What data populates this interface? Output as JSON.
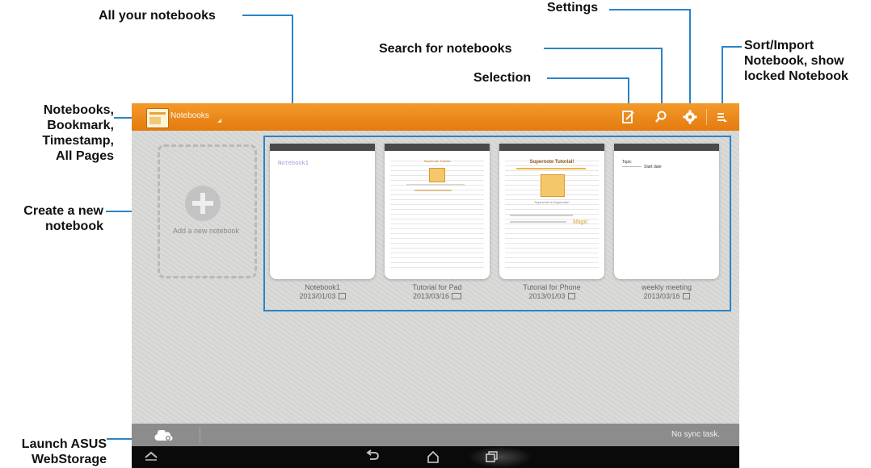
{
  "annotations": {
    "all_notebooks": "All your notebooks",
    "settings": "Settings",
    "search": "Search for notebooks",
    "selection": "Selection",
    "sort_import": [
      "Sort/Import",
      "Notebook, show",
      "locked Notebook"
    ],
    "notebooks_menu": [
      "Notebooks,",
      "Bookmark,",
      "Timestamp,",
      "All Pages"
    ],
    "create_new": [
      "Create a new",
      "notebook"
    ],
    "launch_storage": [
      "Launch ASUS",
      "WebStorage"
    ]
  },
  "app": {
    "title": "Notebooks",
    "icons": [
      "selection-icon",
      "search-icon",
      "settings-icon",
      "sort-menu-icon"
    ],
    "accent_color": "#e8820f"
  },
  "add_notebook": {
    "label": "Add a new notebook"
  },
  "notebooks": [
    {
      "name": "Notebook1",
      "date": "2013/01/03"
    },
    {
      "name": "Tutorial for Pad",
      "date": "2013/03/16"
    },
    {
      "name": "Tutorial for Phone",
      "date": "2013/01/03"
    },
    {
      "name": "weekly meeting",
      "date": "2013/03/16"
    }
  ],
  "thumbs": {
    "nb1": "Notebook1",
    "pad_title": "Supernote Tutorial",
    "phone_title": "Supernote Tutorial!",
    "phone_sub": "Supernote is Supernote!",
    "phone_tag": "Magic",
    "meeting_topic": "Topic",
    "meeting_date": "Start date"
  },
  "status": {
    "sync": "No sync task."
  },
  "navbar": {
    "icons": [
      "collapse-icon",
      "back-icon",
      "home-icon",
      "recent-apps-icon"
    ]
  }
}
